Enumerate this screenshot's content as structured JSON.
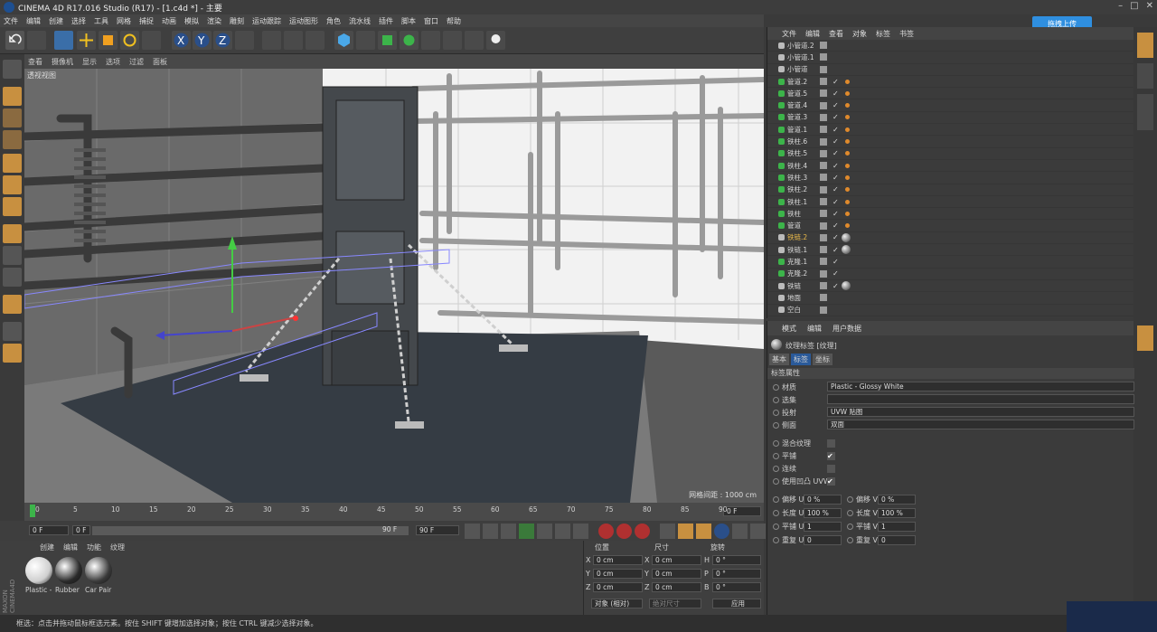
{
  "window": {
    "title": "CINEMA 4D R17.016 Studio (R17) - [1.c4d *] - 主要"
  },
  "menu": [
    "文件",
    "编辑",
    "创建",
    "选择",
    "工具",
    "网格",
    "捕捉",
    "动画",
    "模拟",
    "渲染",
    "雕刻",
    "运动跟踪",
    "运动图形",
    "角色",
    "流水线",
    "插件",
    "脚本",
    "窗口",
    "帮助"
  ],
  "upload_button": "拖拽上传",
  "viewport": {
    "menu": [
      "查看",
      "摄像机",
      "显示",
      "选项",
      "过滤",
      "面板"
    ],
    "label": "透视视图",
    "grid_info": "网格间距 : 1000 cm"
  },
  "timeline": {
    "ticks": [
      "0",
      "5",
      "10",
      "15",
      "20",
      "25",
      "30",
      "35",
      "40",
      "45",
      "50",
      "55",
      "60",
      "65",
      "70",
      "75",
      "80",
      "85",
      "90"
    ],
    "end_frame": "0 F",
    "start_field": "0 F",
    "range_start": "0 F",
    "range_end": "90 F",
    "max_field": "90 F"
  },
  "material_manager": {
    "menu": [
      "创建",
      "编辑",
      "功能",
      "纹理"
    ],
    "materials": [
      {
        "name": "Plastic -",
        "color": "#cfcfcf"
      },
      {
        "name": "Rubber",
        "color": "#2a2a2a"
      },
      {
        "name": "Car Pair",
        "color": "#3a3a3a"
      }
    ]
  },
  "coordinates": {
    "headers": [
      "位置",
      "尺寸",
      "旋转"
    ],
    "rows": [
      {
        "axis": "X",
        "pos": "0 cm",
        "size_axis": "X",
        "size": "0 cm",
        "rot_axis": "H",
        "rot": "0 °"
      },
      {
        "axis": "Y",
        "pos": "0 cm",
        "size_axis": "Y",
        "size": "0 cm",
        "rot_axis": "P",
        "rot": "0 °"
      },
      {
        "axis": "Z",
        "pos": "0 cm",
        "size_axis": "Z",
        "size": "0 cm",
        "rot_axis": "B",
        "rot": "0 °"
      }
    ],
    "mode_select": "对象 (相对)",
    "size_select": "绝对尺寸",
    "apply_button": "应用"
  },
  "object_manager": {
    "menu": [
      "文件",
      "编辑",
      "查看",
      "对象",
      "标签",
      "书签"
    ],
    "objects": [
      {
        "name": "小管道.2",
        "tag": "none",
        "color": "#d8d8d8"
      },
      {
        "name": "小管道.1",
        "tag": "none",
        "color": "#d8d8d8"
      },
      {
        "name": "小管道",
        "tag": "none",
        "color": "#d8d8d8"
      },
      {
        "name": "管道.2",
        "tag": "dots",
        "color": "#d8d8d8"
      },
      {
        "name": "管道.5",
        "tag": "dots",
        "color": "#d8d8d8"
      },
      {
        "name": "管道.4",
        "tag": "dots",
        "color": "#d8d8d8"
      },
      {
        "name": "管道.3",
        "tag": "dots",
        "color": "#d8d8d8"
      },
      {
        "name": "管道.1",
        "tag": "dots",
        "color": "#d8d8d8"
      },
      {
        "name": "铁柱.6",
        "tag": "dots",
        "color": "#d8d8d8"
      },
      {
        "name": "铁柱.5",
        "tag": "dots",
        "color": "#d8d8d8"
      },
      {
        "name": "铁柱.4",
        "tag": "dots",
        "color": "#d8d8d8"
      },
      {
        "name": "铁柱.3",
        "tag": "dots",
        "color": "#d8d8d8"
      },
      {
        "name": "铁柱.2",
        "tag": "dots",
        "color": "#d8d8d8"
      },
      {
        "name": "铁柱.1",
        "tag": "dots",
        "color": "#d8d8d8"
      },
      {
        "name": "铁柱",
        "tag": "dots",
        "color": "#d8d8d8"
      },
      {
        "name": "管道",
        "tag": "dots",
        "color": "#d8d8d8"
      },
      {
        "name": "铁链.2",
        "tag": "ball",
        "color": "#e8b84a"
      },
      {
        "name": "铁链.1",
        "tag": "ball",
        "color": "#d8d8d8"
      },
      {
        "name": "克隆.1",
        "tag": "check",
        "color": "#d8d8d8"
      },
      {
        "name": "克隆.2",
        "tag": "check",
        "color": "#d8d8d8"
      },
      {
        "name": "铁链",
        "tag": "ball",
        "color": "#d8d8d8"
      },
      {
        "name": "地面",
        "tag": "none",
        "color": "#d8d8d8"
      },
      {
        "name": "空白",
        "tag": "none",
        "color": "#d8d8d8"
      }
    ]
  },
  "attributes": {
    "menu": [
      "模式",
      "编辑",
      "用户数据"
    ],
    "title": "纹理标签 [纹理]",
    "tabs": [
      "基本",
      "标签",
      "坐标"
    ],
    "section": "标签属性",
    "material_label": "材质",
    "material_value": "Plastic - Glossy White",
    "selection_label": "选集",
    "projection_label": "投射",
    "projection_value": "UVW 贴图",
    "side_label": "侧面",
    "side_value": "双面",
    "checks": [
      {
        "label": "混合纹理",
        "checked": ""
      },
      {
        "label": "平铺",
        "checked": "✔"
      },
      {
        "label": "连续",
        "checked": ""
      },
      {
        "label": "使用凹凸 UVW",
        "checked": "✔"
      }
    ],
    "numeric": [
      {
        "l1": "偏移 U",
        "v1": "0 %",
        "l2": "偏移 V",
        "v2": "0 %"
      },
      {
        "l1": "长度 U",
        "v1": "100 %",
        "l2": "长度 V",
        "v2": "100 %"
      },
      {
        "l1": "平铺 U",
        "v1": "1",
        "l2": "平铺 V",
        "v2": "1"
      },
      {
        "l1": "重复 U",
        "v1": "0",
        "l2": "重复 V",
        "v2": "0"
      }
    ]
  },
  "status": "框选：点击并拖动鼠标框选元素。按住 SHIFT 键增加选择对象；按住 CTRL 键减少选择对象。"
}
